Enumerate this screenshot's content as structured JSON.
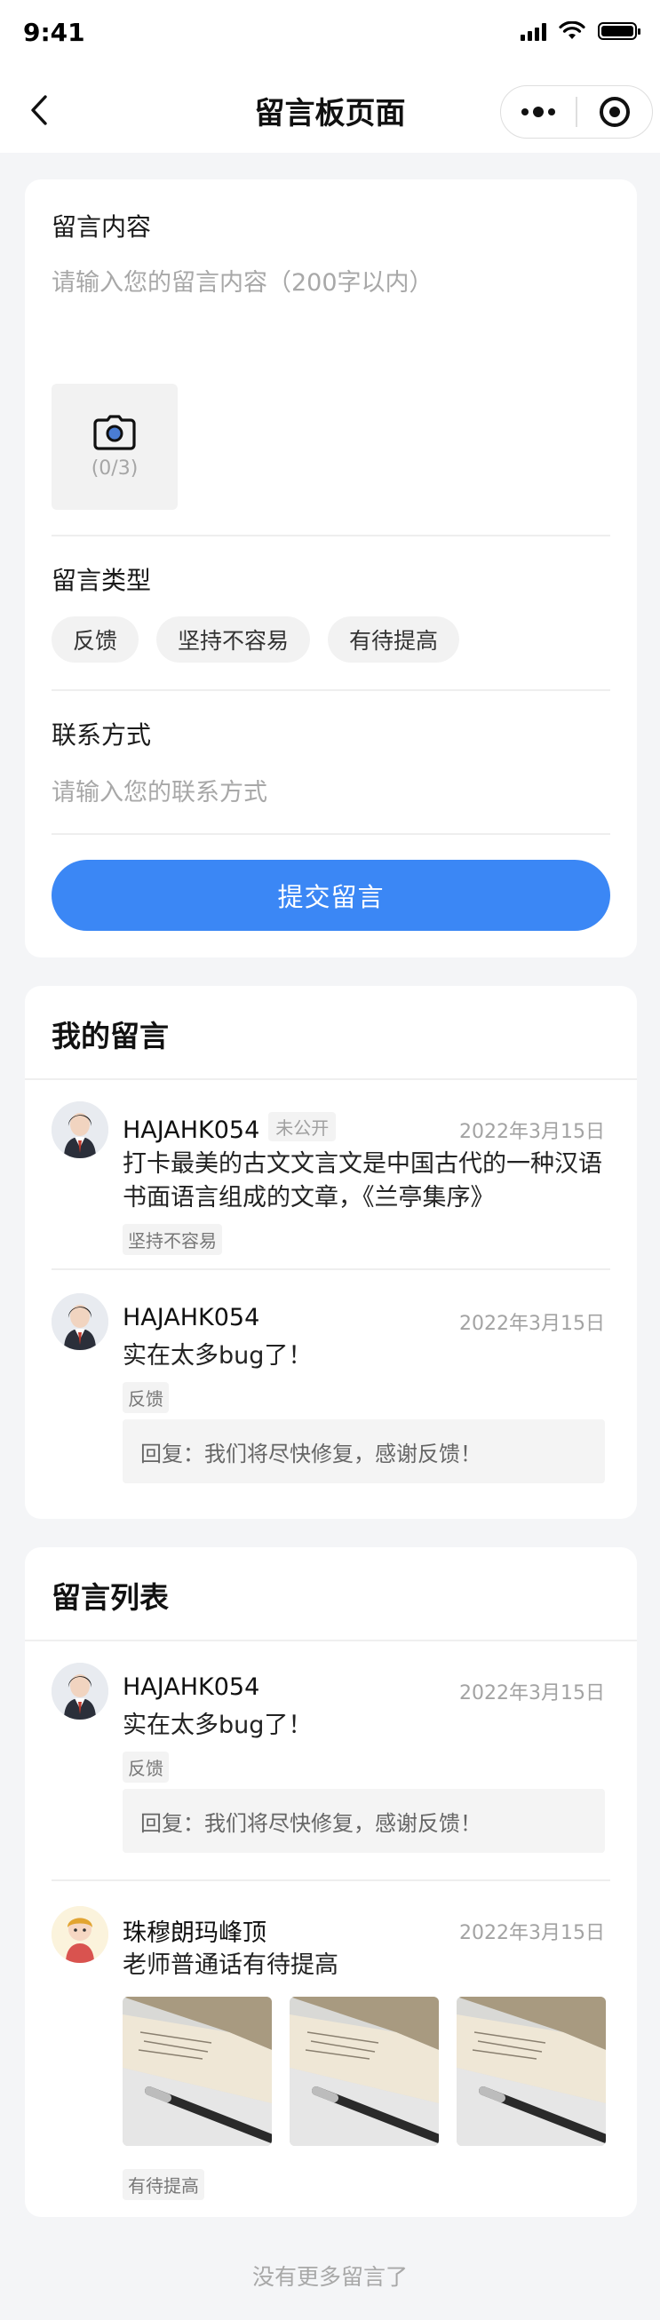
{
  "status_bar": {
    "time": "9:41"
  },
  "nav": {
    "title": "留言板页面"
  },
  "form": {
    "content_label": "留言内容",
    "content_placeholder": "请输入您的留言内容（200字以内）",
    "upload_count": "(0/3)",
    "type_label": "留言类型",
    "types": [
      "反馈",
      "坚持不容易",
      "有待提高"
    ],
    "contact_label": "联系方式",
    "contact_placeholder": "请输入您的联系方式",
    "submit_label": "提交留言"
  },
  "my_messages": {
    "title": "我的留言",
    "items": [
      {
        "name": "HAJAHK054",
        "private_label": "未公开",
        "date": "2022年3月15日",
        "text": "打卡最美的古文文言文是中国古代的一种汉语书面语言组成的文章，《兰亭集序》",
        "tag": "坚持不容易"
      },
      {
        "name": "HAJAHK054",
        "date": "2022年3月15日",
        "text": "实在太多bug了！",
        "tag": "反馈",
        "reply": "回复：我们将尽快修复，感谢反馈！"
      }
    ]
  },
  "message_list": {
    "title": "留言列表",
    "items": [
      {
        "name": "HAJAHK054",
        "date": "2022年3月15日",
        "text": "实在太多bug了！",
        "tag": "反馈",
        "reply": "回复：我们将尽快修复，感谢反馈！"
      },
      {
        "name": "珠穆朗玛峰顶",
        "date": "2022年3月15日",
        "text": "老师普通话有待提高",
        "tag": "有待提高",
        "image_count": 3
      }
    ]
  },
  "footer": {
    "text": "没有更多留言了"
  },
  "colors": {
    "accent": "#3b87f5",
    "background": "#f4f5f7"
  }
}
